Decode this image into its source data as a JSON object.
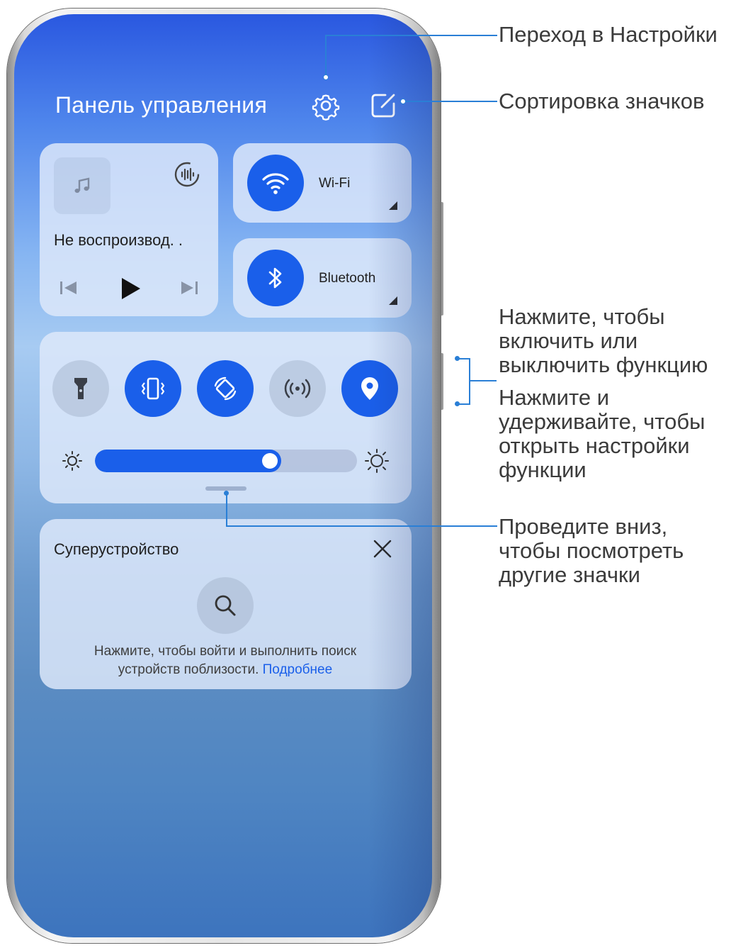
{
  "panel": {
    "title": "Панель управления",
    "icons": {
      "settings": "gear-icon",
      "edit": "edit-icon"
    }
  },
  "media": {
    "title": "Не воспроизвод. .",
    "icons": [
      "music-note-icon",
      "audio-output-icon",
      "previous-icon",
      "play-icon",
      "next-icon"
    ]
  },
  "tiles": [
    {
      "label": "Wi-Fi",
      "icon": "wifi-icon",
      "state": "on"
    },
    {
      "label": "Bluetooth",
      "icon": "bluetooth-icon",
      "state": "on"
    }
  ],
  "toggles": [
    {
      "icon": "flashlight-icon",
      "state": "off"
    },
    {
      "icon": "vibrate-icon",
      "state": "on"
    },
    {
      "icon": "auto-rotate-icon",
      "state": "on"
    },
    {
      "icon": "hotspot-icon",
      "state": "off"
    },
    {
      "icon": "location-icon",
      "state": "on"
    }
  ],
  "brightness": {
    "level": 0.71
  },
  "superdevice": {
    "title": "Суперустройство",
    "desc_line1": "Нажмите, чтобы войти и выполнить поиск",
    "desc_line2": "устройств поблизости.",
    "link": "Подробнее"
  },
  "annotations": {
    "settings": "Переход в Настройки",
    "sort": "Сортировка значков",
    "toggle_1": "Нажмите, чтобы",
    "toggle_2": "включить или",
    "toggle_3": "выключить функцию",
    "hold_1": "Нажмите и",
    "hold_2": "удерживайте, чтобы",
    "hold_3": "открыть настройки",
    "hold_4": "функции",
    "swipe_1": "Проведите вниз,",
    "swipe_2": "чтобы посмотреть",
    "swipe_3": "другие значки"
  },
  "colors": {
    "accent": "#1a5fea",
    "callout_line": "#2a7fd6"
  }
}
